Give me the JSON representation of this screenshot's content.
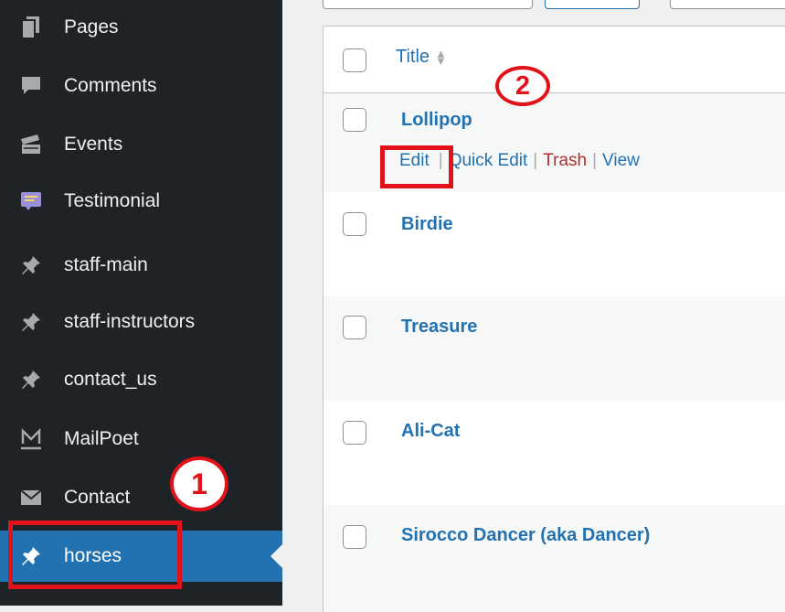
{
  "sidebar": {
    "items": [
      {
        "label": "Pages",
        "icon": "pages-icon"
      },
      {
        "label": "Comments",
        "icon": "comments-icon"
      },
      {
        "label": "Events",
        "icon": "events-icon"
      },
      {
        "label": "Testimonial",
        "icon": "testimonial-icon"
      },
      {
        "label": "staff-main",
        "icon": "pin-icon"
      },
      {
        "label": "staff-instructors",
        "icon": "pin-icon"
      },
      {
        "label": "contact_us",
        "icon": "pin-icon"
      },
      {
        "label": "MailPoet",
        "icon": "mailpoet-icon"
      },
      {
        "label": "Contact",
        "icon": "envelope-icon"
      },
      {
        "label": "horses",
        "icon": "pin-icon",
        "active": true
      }
    ]
  },
  "table": {
    "header": {
      "title": "Title"
    },
    "rows": [
      {
        "title": "Lollipop"
      },
      {
        "title": "Birdie"
      },
      {
        "title": "Treasure"
      },
      {
        "title": "Ali-Cat"
      },
      {
        "title": "Sirocco Dancer (aka Dancer)"
      }
    ],
    "row_actions": {
      "edit": "Edit",
      "quick_edit": "Quick Edit",
      "trash": "Trash",
      "view": "View",
      "separator": "|"
    }
  },
  "annotations": {
    "one": "1",
    "two": "2",
    "color": "#e2121b"
  },
  "colors": {
    "sidebar_bg": "#1d2327",
    "active_bg": "#2271b1",
    "link": "#2271b1",
    "trash": "#b32d2e"
  }
}
